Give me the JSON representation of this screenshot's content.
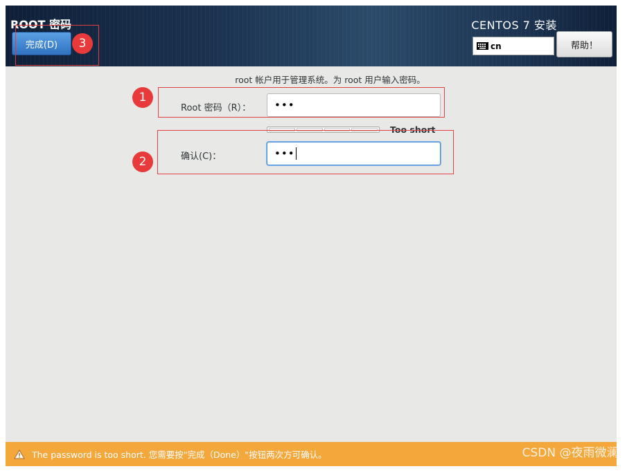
{
  "header": {
    "title": "ROOT 密码",
    "done_label": "完成(D)",
    "product_title": "CENTOS 7 安装",
    "keyboard_layout": "cn",
    "help_label": "帮助！"
  },
  "main": {
    "intro": "root 帐户用于管理系统。为 root 用户输入密码。",
    "root_password_label": "Root 密码（R）：",
    "root_password_value": "•••",
    "confirm_label": "确认(C)：",
    "confirm_value": "•••",
    "strength": {
      "label": "Too short",
      "fraction": 0
    }
  },
  "status": {
    "message": "The password is too short. 您需要按\"完成（Done）\"按钮两次方可确认。"
  },
  "annotations": {
    "badge_1": "1",
    "badge_2": "2",
    "badge_3": "3",
    "color": "#e04040"
  },
  "watermark": "CSDN @夜雨微澜°",
  "colors": {
    "accent": "#2f72c0",
    "warning": "#f4a73a",
    "header": "#1b3350"
  }
}
